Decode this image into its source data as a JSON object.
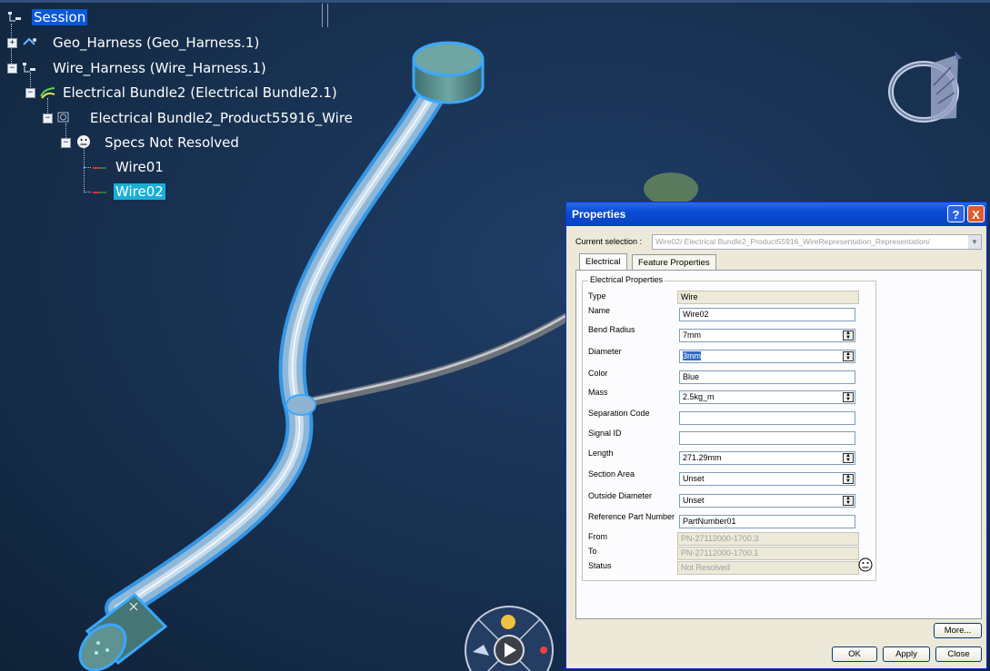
{
  "tree": {
    "session": "Session",
    "geo_harness": "Geo_Harness (Geo_Harness.1)",
    "wire_harness": "Wire_Harness (Wire_Harness.1)",
    "bundle": "Electrical Bundle2 (Electrical Bundle2.1)",
    "bundle_product": "Electrical Bundle2_Product55916_Wire",
    "specs": "Specs Not Resolved",
    "wire01": "Wire01",
    "wire02": "Wire02"
  },
  "dialog": {
    "title": "Properties",
    "help": "?",
    "close": "X",
    "current_selection_label": "Current selection :",
    "current_selection_value": "Wire02/ Electrical Bundle2_Product55916_WireRepresentation_Representation/",
    "tabs": [
      "Electrical",
      "Feature Properties"
    ],
    "group_title": "Electrical Properties",
    "fields": {
      "type": {
        "label": "Type",
        "value": "Wire"
      },
      "name": {
        "label": "Name",
        "value": "Wire02"
      },
      "bend_radius": {
        "label": "Bend Radius",
        "value": "7mm"
      },
      "diameter": {
        "label": "Diameter",
        "value": "3mm"
      },
      "color": {
        "label": "Color",
        "value": "Blue"
      },
      "mass": {
        "label": "Mass",
        "value": "2.5kg_m"
      },
      "separation_code": {
        "label": "Separation Code",
        "value": ""
      },
      "signal_id": {
        "label": "Signal ID",
        "value": ""
      },
      "length": {
        "label": "Length",
        "value": "271.29mm"
      },
      "section_area": {
        "label": "Section Area",
        "value": "Unset"
      },
      "outside_diameter": {
        "label": "Outside Diameter",
        "value": "Unset"
      },
      "ref_part_number": {
        "label": "Reference Part Number",
        "value": "PartNumber01"
      },
      "from": {
        "label": "From",
        "value": "PN-27112000-1700.3"
      },
      "to": {
        "label": "To",
        "value": "PN-27112000-1700.1"
      },
      "status": {
        "label": "Status",
        "value": "Not Resolved"
      }
    },
    "buttons": {
      "more": "More...",
      "ok": "OK",
      "apply": "Apply",
      "close": "Close"
    }
  },
  "colors": {
    "background": "#17304f",
    "wire_glow": "#3aa8ff",
    "selection": "#0a58d6",
    "dialog_title": "#0a4cd6",
    "dialog_bg": "#ece9d8"
  },
  "icons": [
    "tree-root-icon",
    "geo-harness-icon",
    "product-icon",
    "bundle-icon",
    "wire-representation-icon",
    "smiley-icon",
    "wire-icon",
    "compass-icon",
    "navigation-wheel-icon"
  ]
}
